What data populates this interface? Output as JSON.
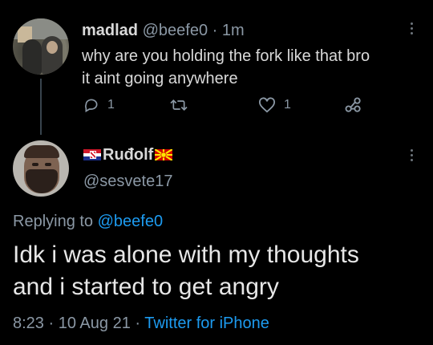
{
  "reply_tweet": {
    "display_name": "madlad",
    "handle": "@beefe0",
    "separator": "·",
    "time": "1m",
    "text_line1": "why are you holding the fork like that bro",
    "text_line2": "it aint going anywhere",
    "reply_count": "1",
    "like_count": "1",
    "icons": [
      "reply-icon",
      "retweet-icon",
      "like-icon",
      "share-icon",
      "more-icon"
    ]
  },
  "focal_tweet": {
    "display_name": "Ruđolf",
    "handle": "@sesvete17",
    "replying_prefix": "Replying to",
    "replying_to": "@beefe0",
    "text_line1": "Idk i was alone with my thoughts",
    "text_line2": "and i started to get angry",
    "time": "8:23",
    "date": "10 Aug 21",
    "separator": "·",
    "source": "Twitter for iPhone",
    "flags": [
      "croatia-flag",
      "north-macedonia-flag"
    ]
  },
  "colors": {
    "background": "#000000",
    "text": "#d9d9d9",
    "muted": "#8b98a5",
    "link": "#1d9bf0",
    "thread_line": "#38444d"
  }
}
